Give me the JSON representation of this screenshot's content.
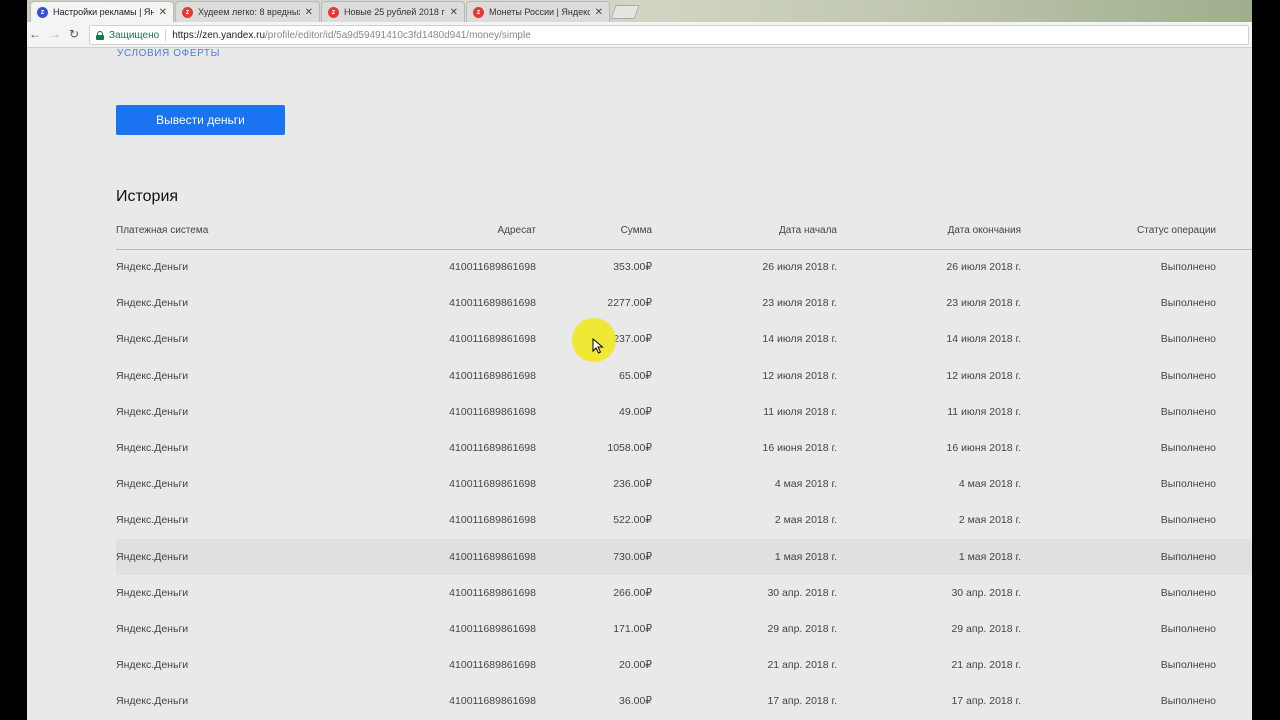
{
  "browser": {
    "tabs": [
      {
        "title": "Настройки рекламы | Ян",
        "active": true,
        "favicon_color": "#3b4fd1"
      },
      {
        "title": "Худеем легко: 8 вредных",
        "active": false,
        "favicon_color": "#e53935"
      },
      {
        "title": "Новые 25 рублей 2018 г",
        "active": false,
        "favicon_color": "#e53935"
      },
      {
        "title": "Монеты России | Яндекс",
        "active": false,
        "favicon_color": "#e53935"
      }
    ],
    "close_glyph": "✕",
    "secure_label": "Защищено",
    "url_host": "https://zen.yandex.ru",
    "url_path": "/profile/editor/id/5a9d59491410c3fd1480d941/money/simple"
  },
  "page": {
    "terms_link": "УСЛОВИЯ ОФЕРТЫ",
    "withdraw_button": "Вывести деньги",
    "history_title": "История",
    "columns": [
      "Платежная система",
      "Адресат",
      "Сумма",
      "Дата начала",
      "Дата окончания",
      "Статус операции"
    ],
    "rows": [
      [
        "Яндекс.Деньги",
        "410011689861698",
        "353.00₽",
        "26 июля 2018 г.",
        "26 июля 2018 г.",
        "Выполнено"
      ],
      [
        "Яндекс.Деньги",
        "410011689861698",
        "2277.00₽",
        "23 июля 2018 г.",
        "23 июля 2018 г.",
        "Выполнено"
      ],
      [
        "Яндекс.Деньги",
        "410011689861698",
        "237.00₽",
        "14 июля 2018 г.",
        "14 июля 2018 г.",
        "Выполнено"
      ],
      [
        "Яндекс.Деньги",
        "410011689861698",
        "65.00₽",
        "12 июля 2018 г.",
        "12 июля 2018 г.",
        "Выполнено"
      ],
      [
        "Яндекс.Деньги",
        "410011689861698",
        "49.00₽",
        "11 июля 2018 г.",
        "11 июля 2018 г.",
        "Выполнено"
      ],
      [
        "Яндекс.Деньги",
        "410011689861698",
        "1058.00₽",
        "16 июня 2018 г.",
        "16 июня 2018 г.",
        "Выполнено"
      ],
      [
        "Яндекс.Деньги",
        "410011689861698",
        "236.00₽",
        "4 мая 2018 г.",
        "4 мая 2018 г.",
        "Выполнено"
      ],
      [
        "Яндекс.Деньги",
        "410011689861698",
        "522.00₽",
        "2 мая 2018 г.",
        "2 мая 2018 г.",
        "Выполнено"
      ],
      [
        "Яндекс.Деньги",
        "410011689861698",
        "730.00₽",
        "1 мая 2018 г.",
        "1 мая 2018 г.",
        "Выполнено"
      ],
      [
        "Яндекс.Деньги",
        "410011689861698",
        "266.00₽",
        "30 апр. 2018 г.",
        "30 апр. 2018 г.",
        "Выполнено"
      ],
      [
        "Яндекс.Деньги",
        "410011689861698",
        "171.00₽",
        "29 апр. 2018 г.",
        "29 апр. 2018 г.",
        "Выполнено"
      ],
      [
        "Яндекс.Деньги",
        "410011689861698",
        "20.00₽",
        "21 апр. 2018 г.",
        "21 апр. 2018 г.",
        "Выполнено"
      ],
      [
        "Яндекс.Деньги",
        "410011689861698",
        "36.00₽",
        "17 апр. 2018 г.",
        "17 апр. 2018 г.",
        "Выполнено"
      ]
    ],
    "highlighted_row": 8
  },
  "colors": {
    "accent": "#1a73f0",
    "link": "#4a7fd6",
    "secure": "#0b8043",
    "background": "#e9e9e9"
  }
}
